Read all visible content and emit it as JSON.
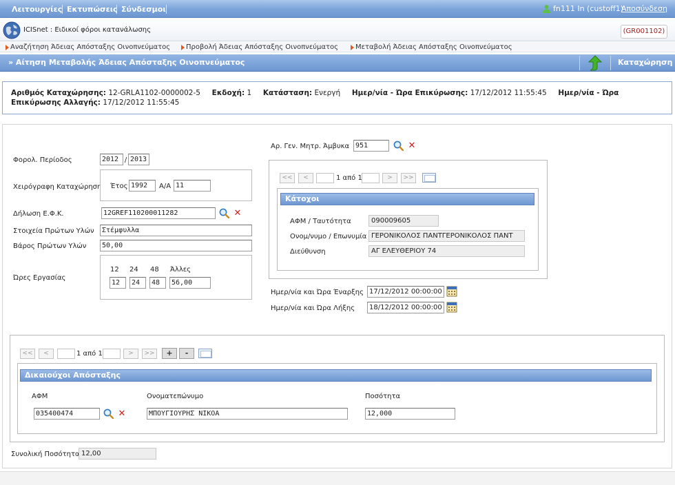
{
  "menu": {
    "items": [
      "Λειτουργίες",
      "Εκτυπώσεις",
      "Σύνδεσμοι"
    ],
    "user": "fn111 In (custoff1)",
    "logout": "Αποσύνδεση"
  },
  "app": {
    "title": "ICISnet : Ειδικοί φόροι κατανάλωσης",
    "code": "(GR001102)"
  },
  "breadcrumb": [
    "Αναζήτηση Άδειας Απόσταξης Οινοπνεύματος",
    "Προβολή Άδειας Απόσταξης Οινοπνεύματος",
    "Μεταβολή Άδειας Απόσταξης Οινοπνεύματος"
  ],
  "section": {
    "title": "» Αίτηση Μεταβολής Άδειας Απόσταξης Οινοπνεύματος",
    "save_label": "Καταχώρηση"
  },
  "info": {
    "reg_no_label": "Αριθμός Καταχώρησης:",
    "reg_no": "12-GRLA1102-0000002-5",
    "version_label": "Εκδοχή:",
    "version": "1",
    "status_label": "Κατάσταση:",
    "status": "Ενεργή",
    "validation_label": "Ημερ/νία - Ώρα Επικύρωσης:",
    "validation": "17/12/2012 11:55:45",
    "change_validation_label": "Ημερ/νία - Ώρα Επικύρωσης Αλλαγής:",
    "change_validation": "17/12/2012 11:55:45"
  },
  "form": {
    "tax_period_label": "Φορολ. Περίοδος",
    "tax_period_from": "2012",
    "tax_period_sep": "/",
    "tax_period_to": "2013",
    "manual_entry_label": "Χειρόγραφη Καταχώρηση",
    "year_label": "Έτος",
    "year": "1992",
    "aa_label": "Α/Α",
    "aa": "11",
    "efk_label": "Δήλωση Ε.Φ.Κ.",
    "efk": "12GREF110200011282",
    "raw_materials_label": "Στοιχεία Πρώτων Υλών",
    "raw_materials": "Στέμφυλλα",
    "raw_weight_label": "Βάρος Πρώτων Υλών",
    "raw_weight": "50,00",
    "hours_label": "Ώρες Εργασίας",
    "hours_headers": [
      "12",
      "24",
      "48",
      "Άλλες"
    ],
    "hours_values": [
      "12",
      "24",
      "48",
      "56,00"
    ],
    "still_reg_label": "Αρ. Γεν. Μητρ. Άμβυκα",
    "still_reg": "951",
    "start_label": "Ημερ/νία και Ώρα Έναρξης",
    "start": "17/12/2012 00:00:00",
    "end_label": "Ημερ/νία και Ώρα Λήξης",
    "end": "18/12/2012 00:00:00",
    "total_label": "Συνολική Ποσότητα",
    "total": "12,00"
  },
  "holders": {
    "pager_text": "1 από 1",
    "title": "Κάτοχοι",
    "afm_label": "ΑΦΜ / Ταυτότητα",
    "afm": "090009605",
    "name_label": "Ονομ/νυμο / Επωνυμία",
    "name": "ΓΕΡΟΝΙΚΟΛΟΣ ΠΑΝΤΓΕΡΟΝΙΚΟΛΟΣ ΠΑΝΤ",
    "address_label": "Διεύθυνση",
    "address": "ΑΓ ΕΛΕΥΘΕΡΙΟΥ 74"
  },
  "beneficiaries": {
    "pager_text": "1 από 1",
    "add": "+",
    "remove": "-",
    "title": "Δικαιούχοι Απόσταξης",
    "col_afm": "ΑΦΜ",
    "col_name": "Ονοματεπώνυμο",
    "col_qty": "Ποσότητα",
    "row": {
      "afm": "035400474",
      "name": "ΜΠΟΥΓΙΟΥΡΗΣ ΝΙΚΟΑ",
      "qty": "12,000"
    }
  },
  "pager": {
    "first": "<<",
    "prev": "<",
    "next": ">",
    "last": ">>"
  },
  "colors": {
    "accent": "#6e98d2",
    "code_text": "#9e1a1a",
    "delete_red": "#d21c1c"
  }
}
